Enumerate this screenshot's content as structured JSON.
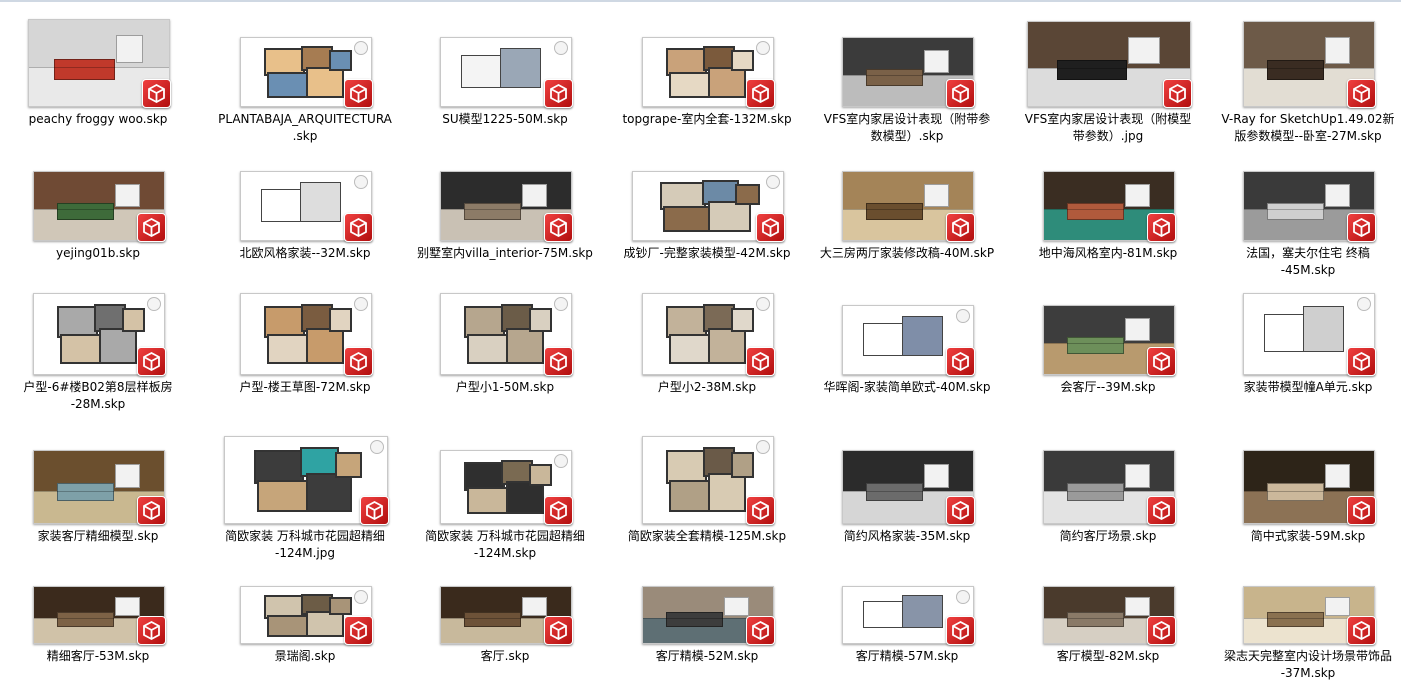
{
  "files": [
    {
      "name": "peachy froggy woo.skp",
      "kind": "interior",
      "colors": [
        "#d6d6d6",
        "#e9e9e9",
        "#c0392b"
      ]
    },
    {
      "name": "PLANTABAJA_ARQUITECTURA\n.skp",
      "kind": "plan",
      "colors": [
        "#e8c08a",
        "#a67c52",
        "#6a8fb3"
      ]
    },
    {
      "name": "SU模型1225-50M.skp",
      "kind": "white",
      "colors": [
        "#f4f4f4",
        "#9aa7b6",
        "#7a5a3a"
      ]
    },
    {
      "name": "topgrape-室内全套-132M.skp",
      "kind": "plan",
      "colors": [
        "#c9a27a",
        "#7b5a3c",
        "#e6d9c4"
      ]
    },
    {
      "name": "VFS室内家居设计表现（附带参\n数模型）.skp",
      "kind": "interior",
      "colors": [
        "#3b3b3b",
        "#bcbcbc",
        "#7a6148"
      ]
    },
    {
      "name": "VFS室内家居设计表现（附模型\n带参数）.jpg",
      "kind": "interior",
      "colors": [
        "#5a4636",
        "#dcdcdc",
        "#1f1f1f"
      ]
    },
    {
      "name": "V-Ray for SketchUp1.49.02新\n版参数模型--卧室-27M.skp",
      "kind": "interior",
      "colors": [
        "#6d5a48",
        "#e2ddd3",
        "#3a2c22"
      ]
    },
    {
      "name": "yejing01b.skp",
      "kind": "interior",
      "colors": [
        "#6f4a34",
        "#d0c7b8",
        "#3e6b3a"
      ]
    },
    {
      "name": "北欧风格家装--32M.skp",
      "kind": "white",
      "colors": [
        "#ffffff",
        "#dddddd",
        "#888888"
      ]
    },
    {
      "name": "别墅室内villa_interior-75M.skp",
      "kind": "interior",
      "colors": [
        "#2c2c2c",
        "#c9c1b4",
        "#8c7b67"
      ]
    },
    {
      "name": "成钞厂-完整家装模型-42M.skp",
      "kind": "plan",
      "colors": [
        "#d5cbb8",
        "#6c8aa6",
        "#8b6b4b"
      ]
    },
    {
      "name": "大三房两厅家装修改稿-40M.skP",
      "kind": "interior",
      "colors": [
        "#a48458",
        "#d9c59e",
        "#6a4e2e"
      ]
    },
    {
      "name": "地中海风格室内-81M.skp",
      "kind": "interior",
      "colors": [
        "#3a2d22",
        "#2e8c7a",
        "#b05a3c"
      ]
    },
    {
      "name": "法国，塞夫尔住宅 终稿\n-45M.skp",
      "kind": "interior",
      "colors": [
        "#3a3a3a",
        "#9b9b9b",
        "#cfcfcf"
      ]
    },
    {
      "name": "户型-6#楼B02第8层样板房\n-28M.skp",
      "kind": "plan",
      "colors": [
        "#a9a9a9",
        "#6f6f6f",
        "#d4c2a6"
      ]
    },
    {
      "name": "户型-楼王草图-72M.skp",
      "kind": "plan",
      "colors": [
        "#c79b6b",
        "#7a5c40",
        "#e1d4c1"
      ]
    },
    {
      "name": "户型小1-50M.skp",
      "kind": "plan",
      "colors": [
        "#b6a68e",
        "#6b5c48",
        "#d9d0c1"
      ]
    },
    {
      "name": "户型小2-38M.skp",
      "kind": "plan",
      "colors": [
        "#c2b29a",
        "#7b6a56",
        "#e0d8cb"
      ]
    },
    {
      "name": "华晖阁-家装简单欧式-40M.skp",
      "kind": "white",
      "colors": [
        "#ffffff",
        "#7f8ea8",
        "#444444"
      ]
    },
    {
      "name": "会客厅--39M.skp",
      "kind": "interior",
      "colors": [
        "#3d3d3d",
        "#b89a6e",
        "#6d8f5a"
      ]
    },
    {
      "name": "家装带模型幢A单元.skp",
      "kind": "white",
      "colors": [
        "#ffffff",
        "#cfcfcf",
        "#555555"
      ]
    },
    {
      "name": "家装客厅精细模型.skp",
      "kind": "interior",
      "colors": [
        "#6b4f2e",
        "#c9b890",
        "#7ea0a8"
      ]
    },
    {
      "name": "简欧家装 万科城市花园超精细\n-124M.jpg",
      "kind": "plan",
      "colors": [
        "#3c3c3c",
        "#2fa3a3",
        "#c6a57a"
      ]
    },
    {
      "name": "简欧家装 万科城市花园超精细\n-124M.skp",
      "kind": "plan",
      "colors": [
        "#2f2f2f",
        "#7a6a52",
        "#c9b79a"
      ]
    },
    {
      "name": "简欧家装全套精模-125M.skp",
      "kind": "plan",
      "colors": [
        "#d8cbb3",
        "#6a5a48",
        "#b0a086"
      ]
    },
    {
      "name": "简约风格家装-35M.skp",
      "kind": "interior",
      "colors": [
        "#2b2b2b",
        "#d6d6d6",
        "#6b6b6b"
      ]
    },
    {
      "name": "简约客厅场景.skp",
      "kind": "interior",
      "colors": [
        "#3a3a3a",
        "#e3e3e3",
        "#9a9a9a"
      ]
    },
    {
      "name": "简中式家装-59M.skp",
      "kind": "interior",
      "colors": [
        "#2d2418",
        "#8c7255",
        "#cbb89b"
      ]
    },
    {
      "name": "精细客厅-53M.skp",
      "kind": "interior",
      "colors": [
        "#3b2a1c",
        "#d0c2a8",
        "#7d6246"
      ]
    },
    {
      "name": "景瑞阁.skp",
      "kind": "plan",
      "colors": [
        "#d0c4ad",
        "#6c5c46",
        "#a89478"
      ]
    },
    {
      "name": "客厅.skp",
      "kind": "interior",
      "colors": [
        "#3a2a1c",
        "#c8b99c",
        "#6d5238"
      ]
    },
    {
      "name": "客厅精模-52M.skp",
      "kind": "interior",
      "colors": [
        "#9a8b7a",
        "#5e6f74",
        "#3d3d3d"
      ]
    },
    {
      "name": "客厅精模-57M.skp",
      "kind": "white",
      "colors": [
        "#ffffff",
        "#8894a8",
        "#4a4a4a"
      ]
    },
    {
      "name": "客厅模型-82M.skp",
      "kind": "interior",
      "colors": [
        "#4a3a2c",
        "#d6cfc3",
        "#8a7a68"
      ]
    },
    {
      "name": "梁志天完整室内设计场景带饰品\n-37M.skp",
      "kind": "interior",
      "colors": [
        "#c8b48c",
        "#ece3cf",
        "#8a7150"
      ]
    }
  ]
}
